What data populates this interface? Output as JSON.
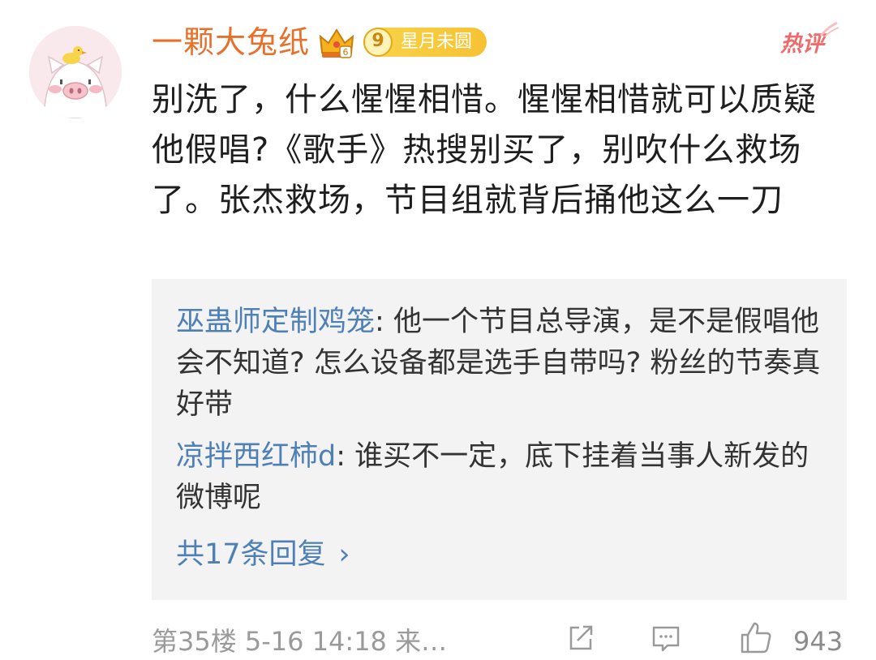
{
  "comment": {
    "username": "一颗大兔纸",
    "level_number": "9",
    "level_title": "星月未圆",
    "hot_label": "热评",
    "text": "别洗了，什么惺惺相惜。惺惺相惜就可以质疑他假唱?《歌手》热搜别买了，别吹什么救场了。张杰救场，节目组就背后捅他这么一刀"
  },
  "replies": [
    {
      "author": "巫蛊师定制鸡笼",
      "separator": ": ",
      "text": "他一个节目总导演，是不是假唱他会不知道? 怎么设备都是选手自带吗? 粉丝的节奏真好带"
    },
    {
      "author": "凉拌西红柿d",
      "separator": ": ",
      "text": "谁买不一定，底下挂着当事人新发的微博呢"
    }
  ],
  "more_replies": {
    "label": "共17条回复",
    "chevron": "›"
  },
  "footer": {
    "floor_time": "第35楼 5-16 14:18 来…",
    "like_count": "943"
  },
  "icons": {
    "share": "share-icon",
    "reply": "comment-icon",
    "like": "thumbs-up-icon"
  },
  "colors": {
    "username": "#e8702a",
    "reply_author": "#4f80b5",
    "hot": "#f16a6a",
    "reply_bg": "#f3f3f3"
  }
}
